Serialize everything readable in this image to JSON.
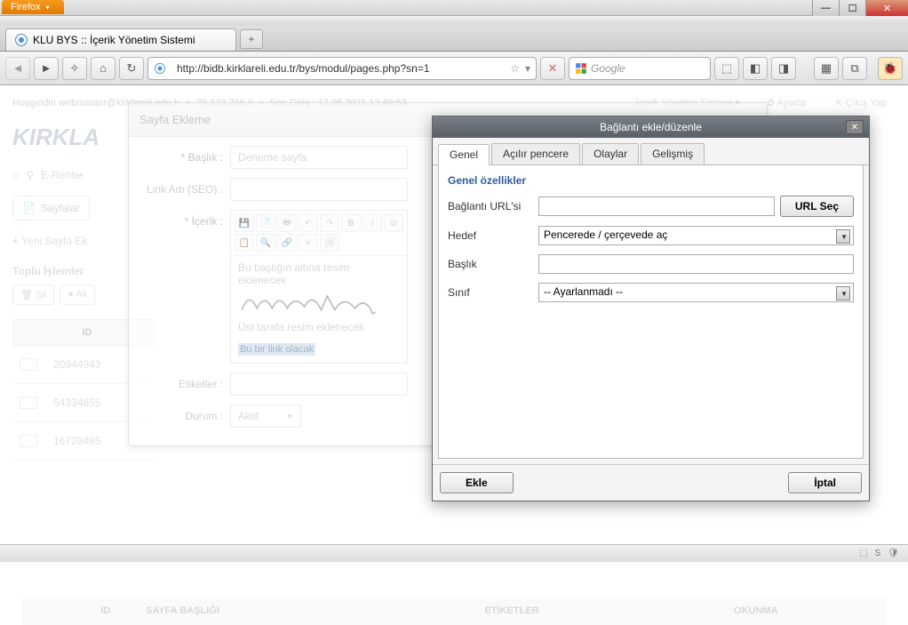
{
  "browser": {
    "name": "Firefox",
    "tab_title": "KLU BYS :: İçerik Yönetim Sistemi",
    "url": "http://bidb.kirklareli.edu.tr/bys/modul/pages.php?sn=1",
    "search_placeholder": "Google"
  },
  "cms": {
    "welcome": "Hoşgeldin webmaster@kirklareli.edu.tr",
    "ip": "79.123.216.9",
    "last_login": "Son Giriş : 17.05.2011 13:49:53",
    "system_label": "İçerik Yönetim Sistemi",
    "settings": "Ayarlar",
    "logout": "Çıkış Yap",
    "logo": "KIRKLA",
    "guide": "E-Rehbe",
    "pages_tab": "Sayfalar",
    "new_page": "+ Yeni Sayfa Ek",
    "bulk_label": "Toplu İşlemler",
    "delete_btn": "Sil",
    "ak_btn": "Ak",
    "col_id": "ID",
    "rows": [
      "20944943",
      "54334655",
      "16728485"
    ],
    "footer": {
      "id": "ID",
      "title": "SAYFA BAŞLIĞI",
      "tags": "ETİKETLER",
      "reads": "OKUNMA"
    }
  },
  "sayfa": {
    "panel_title": "Sayfa Ekleme",
    "labels": {
      "title": "* Başlık :",
      "link": "Link Adı (SEO) :",
      "content": "* İçerik :",
      "tags": "Etiketler :",
      "status": "Durum :"
    },
    "title_value": "Deneme sayfa",
    "editor_lines": {
      "l1": "Bu başlığın altına resim eklenecek",
      "l2": "Üst tarafa resim eklenecek",
      "l3": "Bu bir link olacak"
    },
    "status_value": "Aktif"
  },
  "link": {
    "dialog_title": "Bağlantı ekle/düzenle",
    "tabs": {
      "general": "Genel",
      "popup": "Açılır pencere",
      "events": "Olaylar",
      "advanced": "Gelişmiş"
    },
    "group_label": "Genel özellikler",
    "url_label": "Bağlantı URL'si",
    "url_select": "URL Seç",
    "target_label": "Hedef",
    "target_value": "Pencerede / çerçevede aç",
    "title_label": "Başlık",
    "class_label": "Sınıf",
    "class_value": "-- Ayarlanmadı --",
    "add_btn": "Ekle",
    "cancel_btn": "İptal"
  }
}
